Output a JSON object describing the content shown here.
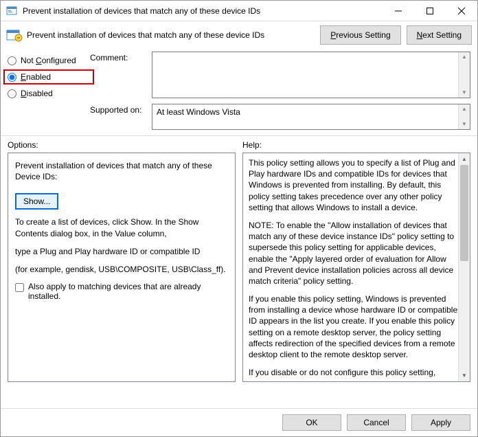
{
  "title": "Prevent installation of devices that match any of these device IDs",
  "header": "Prevent installation of devices that match any of these device IDs",
  "nav": {
    "prev": "Previous Setting",
    "next": "Next Setting"
  },
  "radios": {
    "not_configured_pre": "Not ",
    "not_configured_u": "C",
    "not_configured_post": "onfigured",
    "enabled_u": "E",
    "enabled_post": "nabled",
    "disabled_u": "D",
    "disabled_post": "isabled"
  },
  "labels": {
    "comment": "Comment:",
    "supported": "Supported on:",
    "options": "Options:",
    "help": "Help:"
  },
  "supported_text": "At least Windows Vista",
  "options": {
    "heading": "Prevent installation of devices that match any of these Device IDs:",
    "show": "Show...",
    "p1": "To create a list of devices, click Show. In the Show Contents dialog box, in the Value column,",
    "p2": "type a Plug and Play hardware ID or compatible ID",
    "p3": "(for example, gendisk, USB\\COMPOSITE, USB\\Class_ff).",
    "chk": "Also apply to matching devices that are already installed."
  },
  "help": {
    "p1": "This policy setting allows you to specify a list of Plug and Play hardware IDs and compatible IDs for devices that Windows is prevented from installing. By default, this policy setting takes precedence over any other policy setting that allows Windows to install a device.",
    "p2": "NOTE: To enable the \"Allow installation of devices that match any of these device instance IDs\" policy setting to supersede this policy setting for applicable devices, enable the \"Apply layered order of evaluation for Allow and Prevent device installation policies across all device match criteria\" policy setting.",
    "p3": "If you enable this policy setting, Windows is prevented from installing a device whose hardware ID or compatible ID appears in the list you create. If you enable this policy setting on a remote desktop server, the policy setting affects redirection of the specified devices from a remote desktop client to the remote desktop server.",
    "p4": "If you disable or do not configure this policy setting, devices can be installed and updated as allowed or prevented by other policy"
  },
  "footer": {
    "ok": "OK",
    "cancel": "Cancel",
    "apply": "Apply"
  }
}
